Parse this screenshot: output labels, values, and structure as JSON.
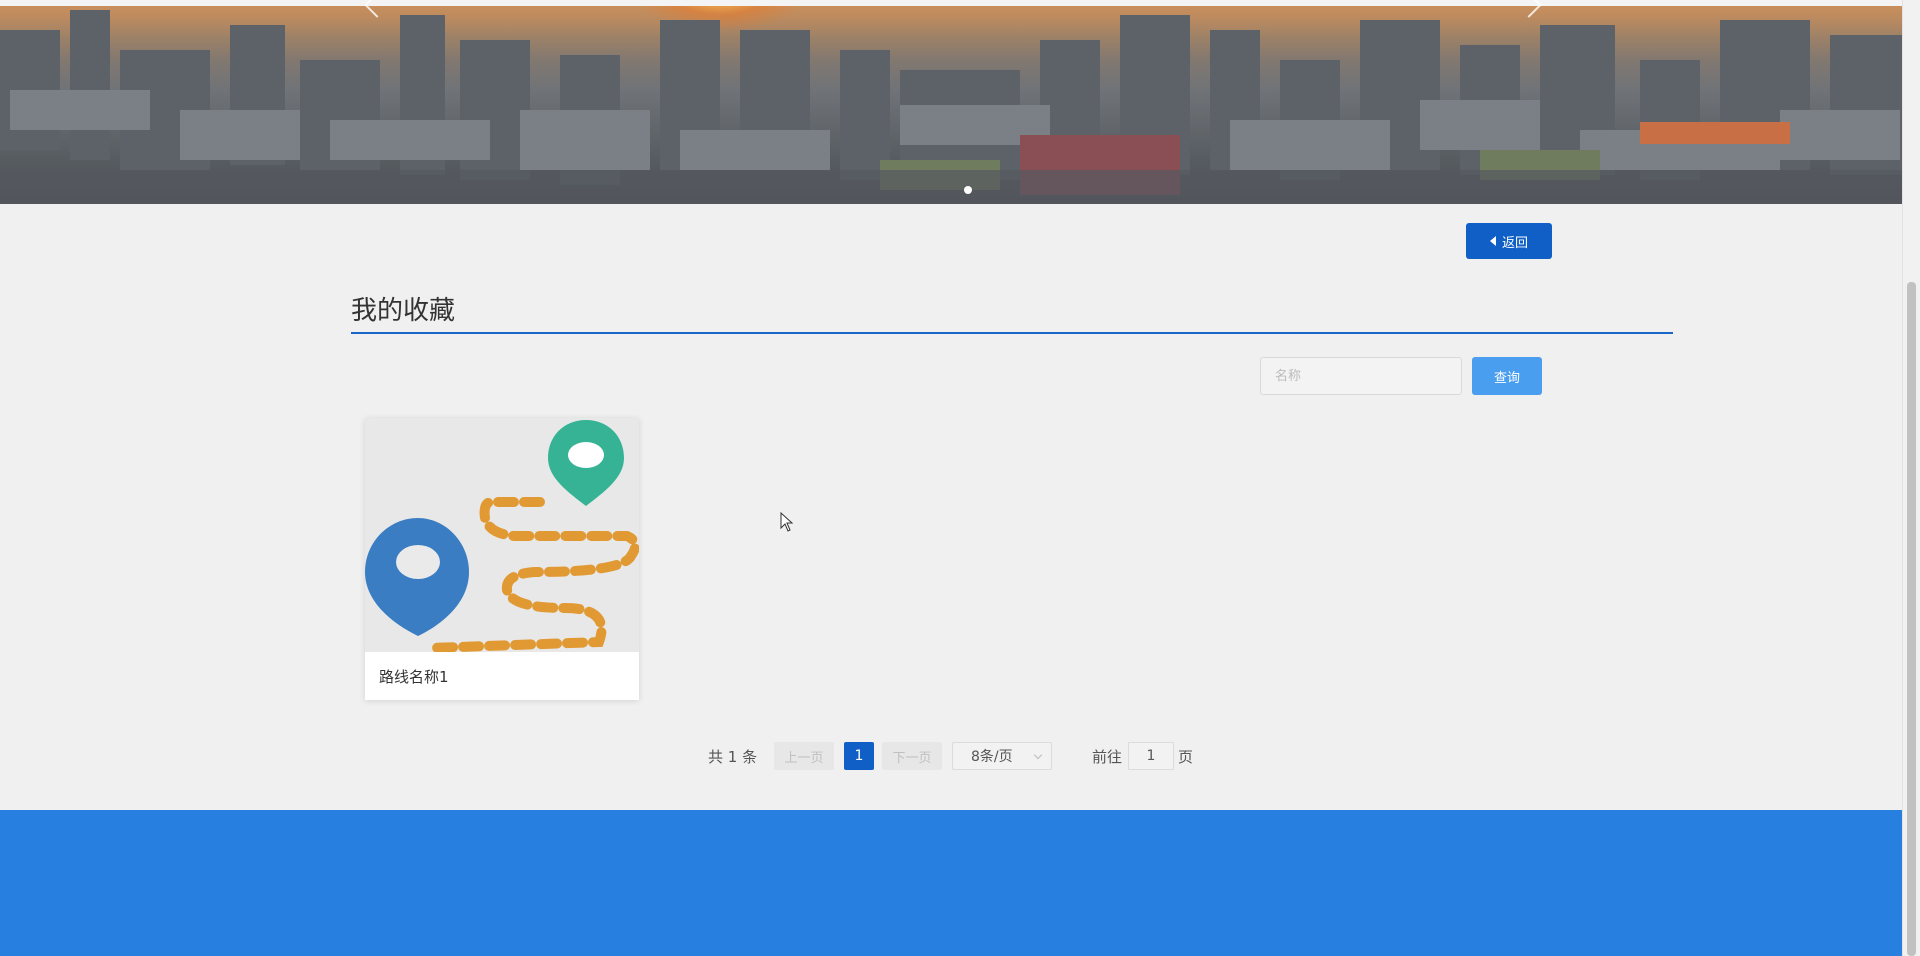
{
  "banner": {
    "active_slide": 1
  },
  "toolbar": {
    "back_label": "返回"
  },
  "page": {
    "title": "我的收藏"
  },
  "search": {
    "placeholder": "名称",
    "value": "",
    "button_label": "查询"
  },
  "favorites": [
    {
      "name": "路线名称1"
    }
  ],
  "pagination": {
    "total_text": "共 1 条",
    "prev_label": "上一页",
    "current_page": "1",
    "next_label": "下一页",
    "page_size_label": "8条/页",
    "goto_label": "前往",
    "goto_value": "1",
    "goto_unit": "页"
  },
  "colors": {
    "primary": "#0f5fc7",
    "accent_button": "#4a9ef0",
    "footer": "#2780e0",
    "pin_blue": "#3a7dc3",
    "pin_green": "#35b394",
    "route_dashes": "#e19a33"
  }
}
